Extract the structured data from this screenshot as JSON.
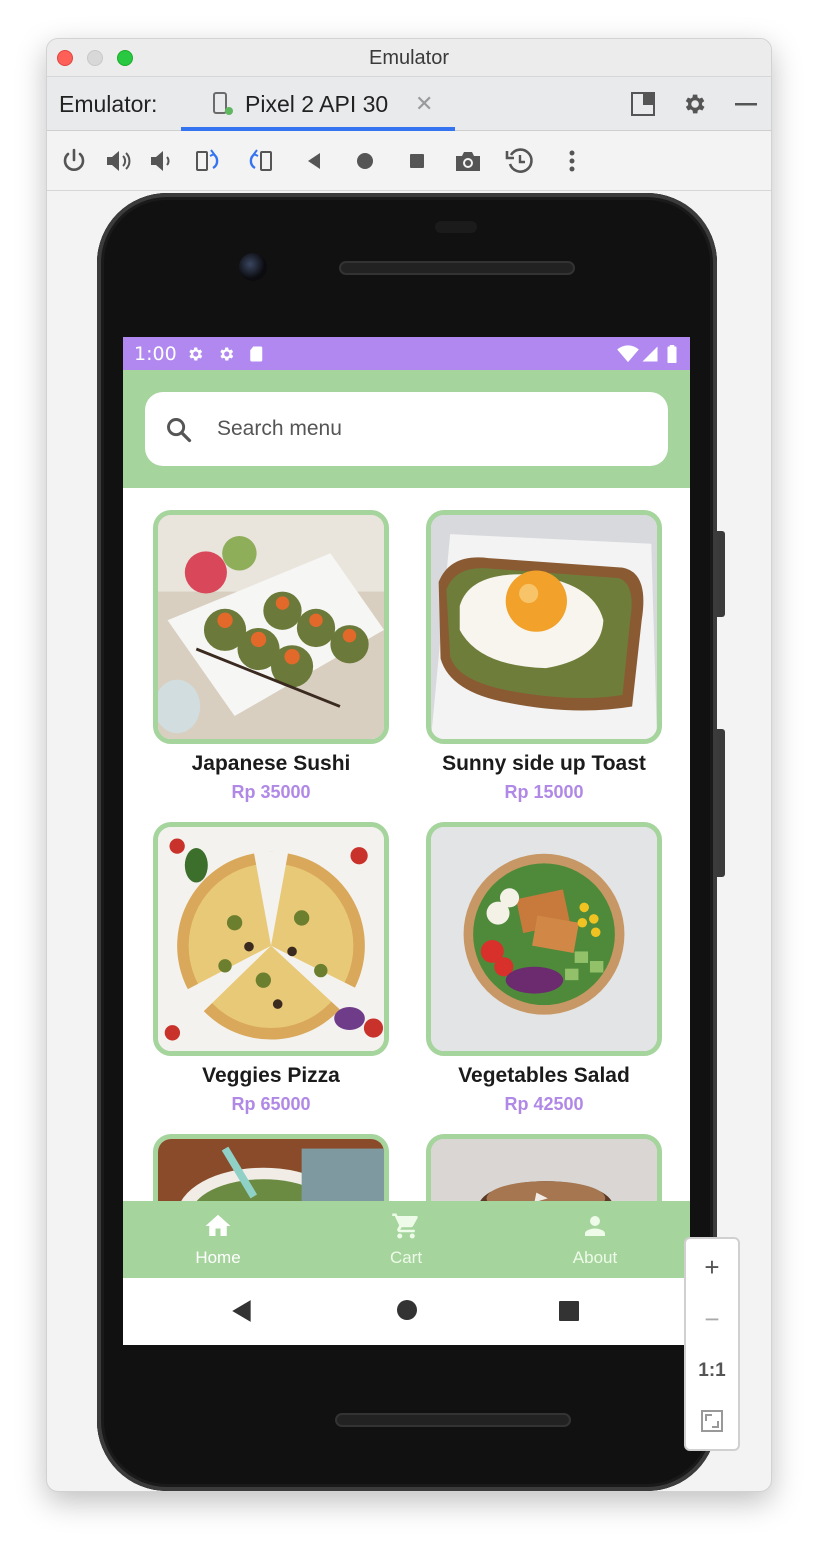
{
  "window": {
    "title": "Emulator"
  },
  "tabbar": {
    "label": "Emulator:",
    "tab_name": "Pixel 2 API 30",
    "close_glyph": "✕"
  },
  "toolbar": {
    "icons": [
      "power-icon",
      "volume-up-icon",
      "volume-down-icon",
      "rotate-left-icon",
      "rotate-right-icon",
      "back-icon",
      "home-icon",
      "overview-icon",
      "screenshot-icon",
      "snapshot-icon",
      "more-icon"
    ]
  },
  "statusbar": {
    "time": "1:00"
  },
  "search": {
    "placeholder": "Search menu"
  },
  "menu": [
    {
      "name": "Japanese Sushi",
      "price": "Rp 35000"
    },
    {
      "name": "Sunny side up Toast",
      "price": "Rp 15000"
    },
    {
      "name": "Veggies Pizza",
      "price": "Rp 65000"
    },
    {
      "name": "Vegetables Salad",
      "price": "Rp 42500"
    }
  ],
  "bottomnav": {
    "home": "Home",
    "cart": "Cart",
    "about": "About"
  },
  "zoom": {
    "in": "+",
    "out": "−",
    "actual": "1:1"
  },
  "colors": {
    "status_bar": "#b088f0",
    "accent_green": "#a5d49d",
    "price_purple": "#b088e6",
    "tab_underline": "#3574f0"
  }
}
